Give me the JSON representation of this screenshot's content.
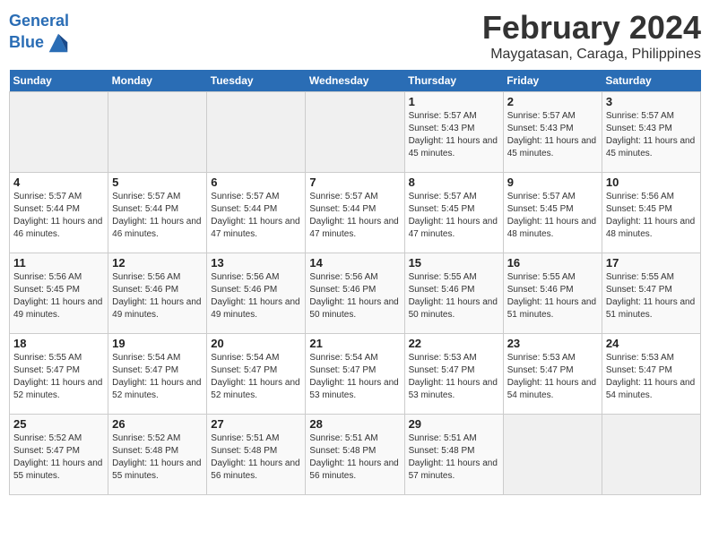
{
  "header": {
    "logo_line1": "General",
    "logo_line2": "Blue",
    "month_title": "February 2024",
    "location": "Maygatasan, Caraga, Philippines"
  },
  "days_of_week": [
    "Sunday",
    "Monday",
    "Tuesday",
    "Wednesday",
    "Thursday",
    "Friday",
    "Saturday"
  ],
  "weeks": [
    [
      {
        "day": "",
        "sunrise": "",
        "sunset": "",
        "daylight": "",
        "empty": true
      },
      {
        "day": "",
        "sunrise": "",
        "sunset": "",
        "daylight": "",
        "empty": true
      },
      {
        "day": "",
        "sunrise": "",
        "sunset": "",
        "daylight": "",
        "empty": true
      },
      {
        "day": "",
        "sunrise": "",
        "sunset": "",
        "daylight": "",
        "empty": true
      },
      {
        "day": "1",
        "sunrise": "Sunrise: 5:57 AM",
        "sunset": "Sunset: 5:43 PM",
        "daylight": "Daylight: 11 hours and 45 minutes.",
        "empty": false
      },
      {
        "day": "2",
        "sunrise": "Sunrise: 5:57 AM",
        "sunset": "Sunset: 5:43 PM",
        "daylight": "Daylight: 11 hours and 45 minutes.",
        "empty": false
      },
      {
        "day": "3",
        "sunrise": "Sunrise: 5:57 AM",
        "sunset": "Sunset: 5:43 PM",
        "daylight": "Daylight: 11 hours and 45 minutes.",
        "empty": false
      }
    ],
    [
      {
        "day": "4",
        "sunrise": "Sunrise: 5:57 AM",
        "sunset": "Sunset: 5:44 PM",
        "daylight": "Daylight: 11 hours and 46 minutes.",
        "empty": false
      },
      {
        "day": "5",
        "sunrise": "Sunrise: 5:57 AM",
        "sunset": "Sunset: 5:44 PM",
        "daylight": "Daylight: 11 hours and 46 minutes.",
        "empty": false
      },
      {
        "day": "6",
        "sunrise": "Sunrise: 5:57 AM",
        "sunset": "Sunset: 5:44 PM",
        "daylight": "Daylight: 11 hours and 47 minutes.",
        "empty": false
      },
      {
        "day": "7",
        "sunrise": "Sunrise: 5:57 AM",
        "sunset": "Sunset: 5:44 PM",
        "daylight": "Daylight: 11 hours and 47 minutes.",
        "empty": false
      },
      {
        "day": "8",
        "sunrise": "Sunrise: 5:57 AM",
        "sunset": "Sunset: 5:45 PM",
        "daylight": "Daylight: 11 hours and 47 minutes.",
        "empty": false
      },
      {
        "day": "9",
        "sunrise": "Sunrise: 5:57 AM",
        "sunset": "Sunset: 5:45 PM",
        "daylight": "Daylight: 11 hours and 48 minutes.",
        "empty": false
      },
      {
        "day": "10",
        "sunrise": "Sunrise: 5:56 AM",
        "sunset": "Sunset: 5:45 PM",
        "daylight": "Daylight: 11 hours and 48 minutes.",
        "empty": false
      }
    ],
    [
      {
        "day": "11",
        "sunrise": "Sunrise: 5:56 AM",
        "sunset": "Sunset: 5:45 PM",
        "daylight": "Daylight: 11 hours and 49 minutes.",
        "empty": false
      },
      {
        "day": "12",
        "sunrise": "Sunrise: 5:56 AM",
        "sunset": "Sunset: 5:46 PM",
        "daylight": "Daylight: 11 hours and 49 minutes.",
        "empty": false
      },
      {
        "day": "13",
        "sunrise": "Sunrise: 5:56 AM",
        "sunset": "Sunset: 5:46 PM",
        "daylight": "Daylight: 11 hours and 49 minutes.",
        "empty": false
      },
      {
        "day": "14",
        "sunrise": "Sunrise: 5:56 AM",
        "sunset": "Sunset: 5:46 PM",
        "daylight": "Daylight: 11 hours and 50 minutes.",
        "empty": false
      },
      {
        "day": "15",
        "sunrise": "Sunrise: 5:55 AM",
        "sunset": "Sunset: 5:46 PM",
        "daylight": "Daylight: 11 hours and 50 minutes.",
        "empty": false
      },
      {
        "day": "16",
        "sunrise": "Sunrise: 5:55 AM",
        "sunset": "Sunset: 5:46 PM",
        "daylight": "Daylight: 11 hours and 51 minutes.",
        "empty": false
      },
      {
        "day": "17",
        "sunrise": "Sunrise: 5:55 AM",
        "sunset": "Sunset: 5:47 PM",
        "daylight": "Daylight: 11 hours and 51 minutes.",
        "empty": false
      }
    ],
    [
      {
        "day": "18",
        "sunrise": "Sunrise: 5:55 AM",
        "sunset": "Sunset: 5:47 PM",
        "daylight": "Daylight: 11 hours and 52 minutes.",
        "empty": false
      },
      {
        "day": "19",
        "sunrise": "Sunrise: 5:54 AM",
        "sunset": "Sunset: 5:47 PM",
        "daylight": "Daylight: 11 hours and 52 minutes.",
        "empty": false
      },
      {
        "day": "20",
        "sunrise": "Sunrise: 5:54 AM",
        "sunset": "Sunset: 5:47 PM",
        "daylight": "Daylight: 11 hours and 52 minutes.",
        "empty": false
      },
      {
        "day": "21",
        "sunrise": "Sunrise: 5:54 AM",
        "sunset": "Sunset: 5:47 PM",
        "daylight": "Daylight: 11 hours and 53 minutes.",
        "empty": false
      },
      {
        "day": "22",
        "sunrise": "Sunrise: 5:53 AM",
        "sunset": "Sunset: 5:47 PM",
        "daylight": "Daylight: 11 hours and 53 minutes.",
        "empty": false
      },
      {
        "day": "23",
        "sunrise": "Sunrise: 5:53 AM",
        "sunset": "Sunset: 5:47 PM",
        "daylight": "Daylight: 11 hours and 54 minutes.",
        "empty": false
      },
      {
        "day": "24",
        "sunrise": "Sunrise: 5:53 AM",
        "sunset": "Sunset: 5:47 PM",
        "daylight": "Daylight: 11 hours and 54 minutes.",
        "empty": false
      }
    ],
    [
      {
        "day": "25",
        "sunrise": "Sunrise: 5:52 AM",
        "sunset": "Sunset: 5:47 PM",
        "daylight": "Daylight: 11 hours and 55 minutes.",
        "empty": false
      },
      {
        "day": "26",
        "sunrise": "Sunrise: 5:52 AM",
        "sunset": "Sunset: 5:48 PM",
        "daylight": "Daylight: 11 hours and 55 minutes.",
        "empty": false
      },
      {
        "day": "27",
        "sunrise": "Sunrise: 5:51 AM",
        "sunset": "Sunset: 5:48 PM",
        "daylight": "Daylight: 11 hours and 56 minutes.",
        "empty": false
      },
      {
        "day": "28",
        "sunrise": "Sunrise: 5:51 AM",
        "sunset": "Sunset: 5:48 PM",
        "daylight": "Daylight: 11 hours and 56 minutes.",
        "empty": false
      },
      {
        "day": "29",
        "sunrise": "Sunrise: 5:51 AM",
        "sunset": "Sunset: 5:48 PM",
        "daylight": "Daylight: 11 hours and 57 minutes.",
        "empty": false
      },
      {
        "day": "",
        "sunrise": "",
        "sunset": "",
        "daylight": "",
        "empty": true
      },
      {
        "day": "",
        "sunrise": "",
        "sunset": "",
        "daylight": "",
        "empty": true
      }
    ]
  ]
}
